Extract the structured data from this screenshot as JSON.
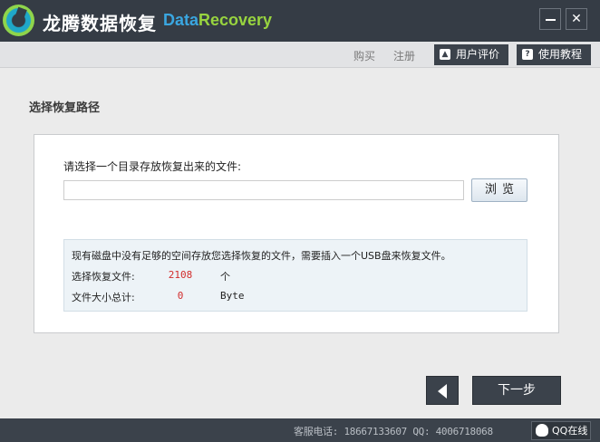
{
  "titlebar": {
    "app_title": "龙腾数据恢复",
    "brand_part1": "Data",
    "brand_part2": "Recovery",
    "close_glyph": "✕"
  },
  "menubar": {
    "buy": "购买",
    "register": "注册",
    "review": "用户评价",
    "tutorial": "使用教程",
    "tutorial_icon_glyph": "?"
  },
  "main": {
    "section_title": "选择恢复路径",
    "prompt": "请选择一个目录存放恢复出来的文件:",
    "path_value": "",
    "browse_label": "浏览",
    "notice": "现有磁盘中没有足够的空间存放您选择恢复的文件，需要插入一个USB盘来恢复文件。",
    "files_label": "选择恢复文件:",
    "files_value": "2108",
    "files_unit": "个",
    "size_label": "文件大小总计:",
    "size_value": "0",
    "size_unit": "Byte",
    "next_label": "下一步"
  },
  "statusbar": {
    "contact": "客服电话: 18667133607 QQ: 4006718068",
    "qq_online": "QQ在线"
  },
  "colors": {
    "titlebar_bg": "#353c45",
    "brand_blue": "#3aa6e0",
    "brand_green": "#98d43f",
    "value_red": "#d22c2c"
  }
}
